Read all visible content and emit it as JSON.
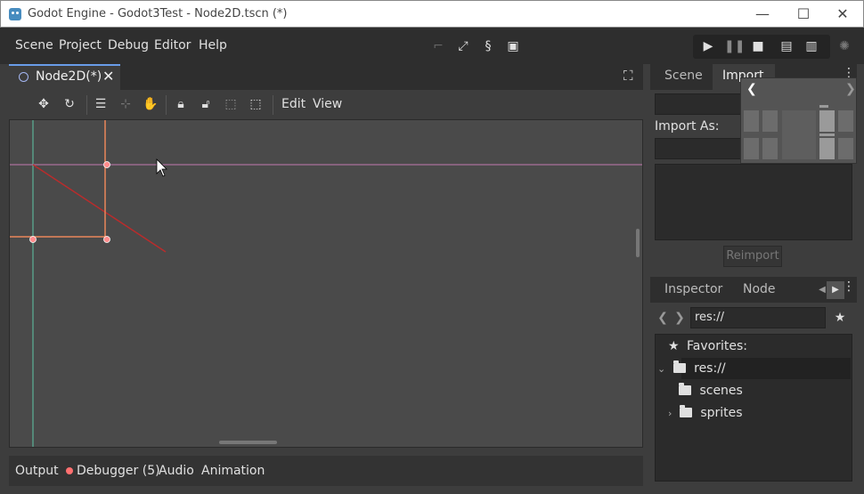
{
  "window": {
    "title": "Godot Engine - Godot3Test - Node2D.tscn (*)"
  },
  "menu": {
    "items": [
      "Scene",
      "Project",
      "Debug",
      "Editor",
      "Help"
    ]
  },
  "scene_tab": {
    "label": "Node2D(*)"
  },
  "toolbar2d": {
    "edit": "Edit",
    "view": "View"
  },
  "bottom": {
    "output": "Output",
    "debugger": "Debugger (5)",
    "audio": "Audio",
    "animation": "Animation"
  },
  "dock": {
    "scene_tab": "Scene",
    "import_tab": "Import",
    "import_as": "Import As:",
    "reimport": "Reimport",
    "inspector_tab": "Inspector",
    "node_tab": "Node",
    "path": "res://"
  },
  "filesystem": {
    "favorites": "Favorites:",
    "root": "res://",
    "folders": [
      "scenes",
      "sprites"
    ]
  },
  "colors": {
    "accent": "#699ce8",
    "selection_orange": "#e9865a",
    "debug_red": "#ff7070"
  }
}
